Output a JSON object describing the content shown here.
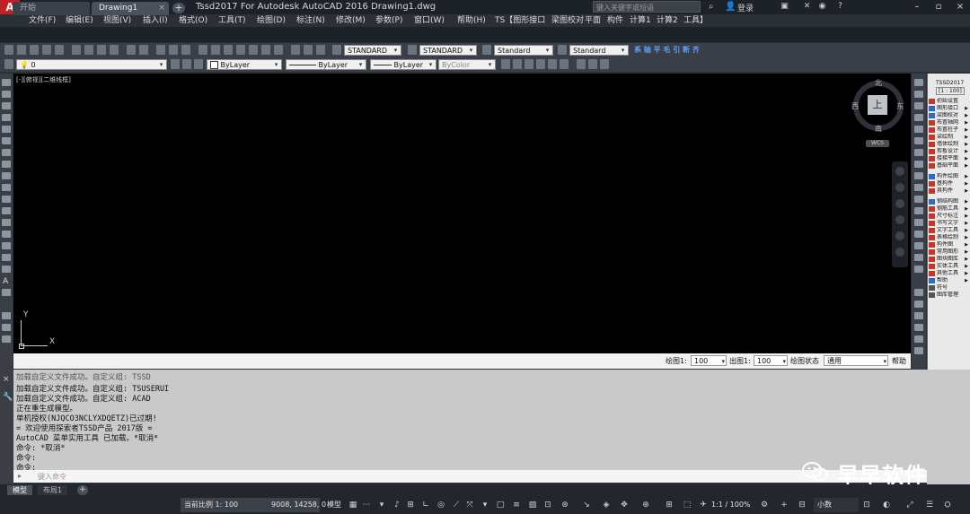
{
  "window": {
    "app_logo": "A",
    "title": "Tssd2017 For Autodesk AutoCAD 2016    Drawing1.dwg",
    "search_placeholder": "键入关键字或短语",
    "login": "登录",
    "controls": [
      "–",
      "▫",
      "×"
    ]
  },
  "menu": [
    "文件(F)",
    "编辑(E)",
    "视图(V)",
    "插入(I)",
    "格式(O)",
    "工具(T)",
    "绘图(D)",
    "标注(N)",
    "修改(M)",
    "参数(P)",
    "窗口(W)",
    "帮助(H)",
    "TS【图形接口",
    "梁图校对",
    "平面",
    "构件",
    "计算1",
    "计算2",
    "工具】"
  ],
  "tabs": [
    {
      "label": "开始",
      "active": false
    },
    {
      "label": "Drawing1",
      "active": true
    }
  ],
  "toolbar1": {
    "text_style": "STANDARD",
    "dim_style": "STANDARD",
    "table_style": "Standard",
    "mleader_style": "Standard",
    "extra_labels": [
      "系",
      "轴",
      "平",
      "毛",
      "引",
      "断",
      "齐"
    ]
  },
  "toolbar2": {
    "layer": "0",
    "color": "ByLayer",
    "linetype": "ByLayer",
    "lineweight": "ByLayer",
    "plotstyle": "ByColor"
  },
  "canvas": {
    "view_label": "[-][俯视][二维线框]",
    "ucs_y": "Y",
    "ucs_x": "X",
    "viewcube": {
      "north": "北",
      "south": "南",
      "east": "东",
      "west": "西",
      "face": "上",
      "wcs": "WCS"
    }
  },
  "scale_bar": {
    "draw_scale_label": "绘图1:",
    "draw_scale_value": "100",
    "out_scale_label": "出图1:",
    "out_scale_value": "100",
    "state_label": "绘图状态",
    "state_value": "通用",
    "help": "帮助"
  },
  "tssd_panel": {
    "title": "TSSD2017",
    "scale": "[1 : 100]",
    "items": [
      "初始设置",
      "图形接口",
      "梁图校对",
      "布置轴网",
      "布置柱子",
      "梁绘制",
      "墙体绘制",
      "剪板设计",
      "楼梯平面",
      "基础平面",
      "构件绘图",
      "基构件",
      "其构件",
      "钢结构图",
      "钢筋工具",
      "尺寸标注",
      "书写文字",
      "文字工具",
      "表格绘制",
      "构件图",
      "常用图形",
      "图块图库",
      "实体工具",
      "其他工具",
      "帮助",
      "符号",
      "图库管理"
    ]
  },
  "command": {
    "history": [
      "加载自定义文件成功。自定义组: TSSD",
      "加载自定义文件成功。自定义组: TSUSERUI",
      "加载自定义文件成功。自定义组: ACAD",
      "正在重生成模型。",
      "单机授权(NJQCO3NCLYXDQETZ)已过期!",
      "= 欢迎使用探索者TSSD产品 2017版 =",
      "AutoCAD 菜单实用工具 已加载。*取消*",
      "命令: *取消*",
      "命令:",
      "命令:"
    ],
    "input_placeholder": "键入命令"
  },
  "watermark": "早早软件",
  "layout_tabs": [
    {
      "label": "模型",
      "active": true
    },
    {
      "label": "布局1",
      "active": false
    }
  ],
  "status": {
    "current_scale": "当前比例 1: 100",
    "coords": "9008, 14258, 0",
    "model": "模型",
    "anno_scale": "1:1 / 100%",
    "units": "小数"
  }
}
